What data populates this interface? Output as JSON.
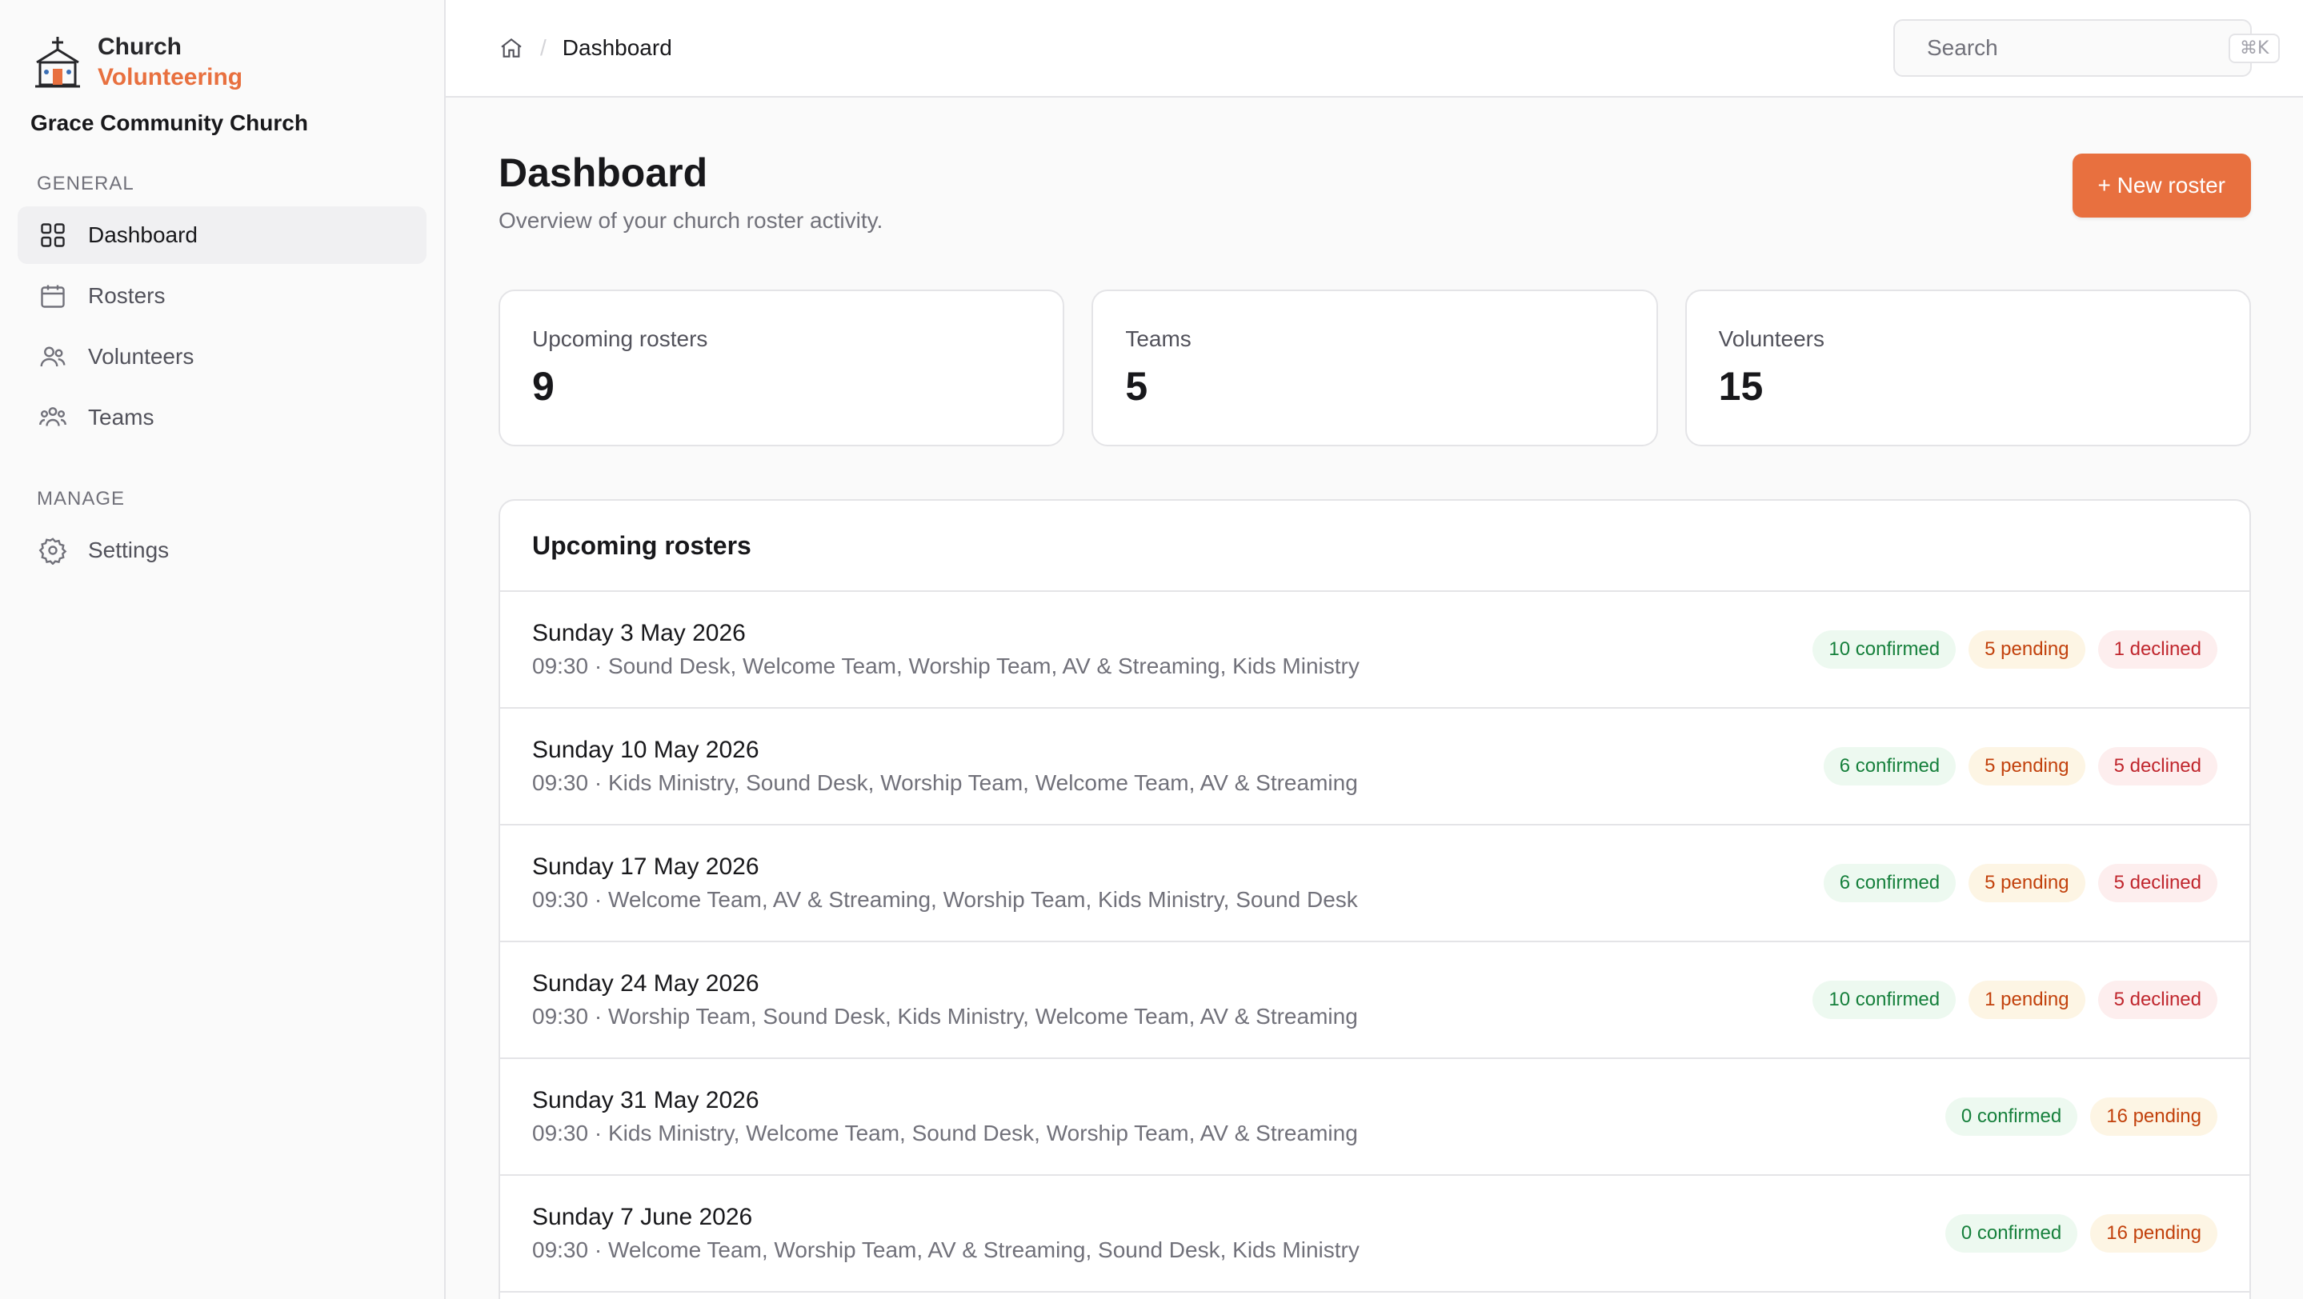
{
  "brand": {
    "line1": "Church",
    "line2": "Volunteering",
    "org": "Grace Community Church"
  },
  "sidebar": {
    "general_label": "GENERAL",
    "manage_label": "MANAGE",
    "items": [
      {
        "label": "Dashboard",
        "icon": "grid-icon",
        "active": true
      },
      {
        "label": "Rosters",
        "icon": "calendar-icon"
      },
      {
        "label": "Volunteers",
        "icon": "users-icon"
      },
      {
        "label": "Teams",
        "icon": "team-icon"
      }
    ],
    "manage_items": [
      {
        "label": "Settings",
        "icon": "gear-icon"
      }
    ]
  },
  "topbar": {
    "breadcrumb": {
      "separator": "/",
      "current": "Dashboard"
    },
    "search": {
      "placeholder": "Search",
      "shortcut": "⌘K"
    }
  },
  "page": {
    "title": "Dashboard",
    "subtitle": "Overview of your church roster activity.",
    "new_button": "+ New roster"
  },
  "stats": [
    {
      "label": "Upcoming rosters",
      "value": "9"
    },
    {
      "label": "Teams",
      "value": "5"
    },
    {
      "label": "Volunteers",
      "value": "15"
    }
  ],
  "rosters": {
    "title": "Upcoming rosters",
    "rows": [
      {
        "date": "Sunday 3 May 2026",
        "teams": "09:30 · Sound Desk, Welcome Team, Worship Team, AV & Streaming, Kids Ministry",
        "confirmed": "10 confirmed",
        "pending": "5 pending",
        "declined": "1 declined"
      },
      {
        "date": "Sunday 10 May 2026",
        "teams": "09:30 · Kids Ministry, Sound Desk, Worship Team, Welcome Team, AV & Streaming",
        "confirmed": "6 confirmed",
        "pending": "5 pending",
        "declined": "5 declined"
      },
      {
        "date": "Sunday 17 May 2026",
        "teams": "09:30 · Welcome Team, AV & Streaming, Worship Team, Kids Ministry, Sound Desk",
        "confirmed": "6 confirmed",
        "pending": "5 pending",
        "declined": "5 declined"
      },
      {
        "date": "Sunday 24 May 2026",
        "teams": "09:30 · Worship Team, Sound Desk, Kids Ministry, Welcome Team, AV & Streaming",
        "confirmed": "10 confirmed",
        "pending": "1 pending",
        "declined": "5 declined"
      },
      {
        "date": "Sunday 31 May 2026",
        "teams": "09:30 · Kids Ministry, Welcome Team, Sound Desk, Worship Team, AV & Streaming",
        "confirmed": "0 confirmed",
        "pending": "16 pending"
      },
      {
        "date": "Sunday 7 June 2026",
        "teams": "09:30 · Welcome Team, Worship Team, AV & Streaming, Sound Desk, Kids Ministry",
        "confirmed": "0 confirmed",
        "pending": "16 pending"
      }
    ]
  },
  "colors": {
    "accent": "#e8703f",
    "confirmed": "#16803c",
    "pending": "#c2410c",
    "declined": "#c0262d"
  }
}
